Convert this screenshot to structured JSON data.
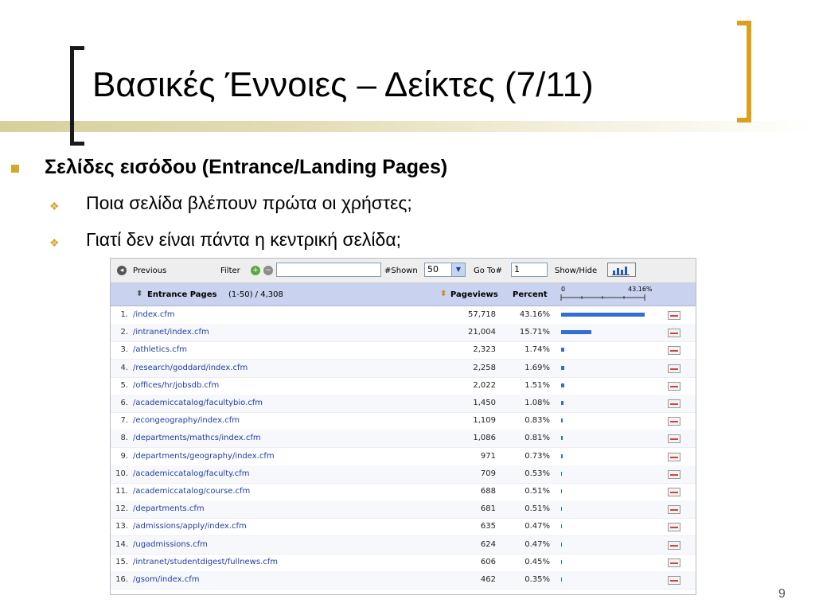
{
  "slide": {
    "title": "Βασικές Έννοιες – Δείκτες (7/11)",
    "bullet": "Σελίδες εισόδου (Entrance/Landing Pages)",
    "subbullets": [
      "Ποια σελίδα βλέπουν πρώτα οι χρήστες;",
      "Γιατί δεν είναι πάντα η κεντρική σελίδα;"
    ],
    "page_number": "9"
  },
  "controls": {
    "previous_label": "Previous",
    "filter_label": "Filter",
    "filter_value": "",
    "shown_label": "#Shown",
    "shown_value": "50",
    "goto_label": "Go To#",
    "goto_value": "1",
    "showhide_label": "Show/Hide"
  },
  "table": {
    "header_pages": "Entrance Pages",
    "header_range": "(1-50) / 4,308",
    "header_pageviews": "Pageviews",
    "header_percent": "Percent",
    "scale_min": "0",
    "scale_max": "43.16%",
    "rows": [
      {
        "num": "1.",
        "page": "/index.cfm",
        "pageviews": "57,718",
        "percent": "43.16%",
        "pct": 43.16
      },
      {
        "num": "2.",
        "page": "/intranet/index.cfm",
        "pageviews": "21,004",
        "percent": "15.71%",
        "pct": 15.71
      },
      {
        "num": "3.",
        "page": "/athletics.cfm",
        "pageviews": "2,323",
        "percent": "1.74%",
        "pct": 1.74
      },
      {
        "num": "4.",
        "page": "/research/goddard/index.cfm",
        "pageviews": "2,258",
        "percent": "1.69%",
        "pct": 1.69
      },
      {
        "num": "5.",
        "page": "/offices/hr/jobsdb.cfm",
        "pageviews": "2,022",
        "percent": "1.51%",
        "pct": 1.51
      },
      {
        "num": "6.",
        "page": "/academiccatalog/facultybio.cfm",
        "pageviews": "1,450",
        "percent": "1.08%",
        "pct": 1.08
      },
      {
        "num": "7.",
        "page": "/econgeography/index.cfm",
        "pageviews": "1,109",
        "percent": "0.83%",
        "pct": 0.83
      },
      {
        "num": "8.",
        "page": "/departments/mathcs/index.cfm",
        "pageviews": "1,086",
        "percent": "0.81%",
        "pct": 0.81
      },
      {
        "num": "9.",
        "page": "/departments/geography/index.cfm",
        "pageviews": "971",
        "percent": "0.73%",
        "pct": 0.73
      },
      {
        "num": "10.",
        "page": "/academiccatalog/faculty.cfm",
        "pageviews": "709",
        "percent": "0.53%",
        "pct": 0.53
      },
      {
        "num": "11.",
        "page": "/academiccatalog/course.cfm",
        "pageviews": "688",
        "percent": "0.51%",
        "pct": 0.51
      },
      {
        "num": "12.",
        "page": "/departments.cfm",
        "pageviews": "681",
        "percent": "0.51%",
        "pct": 0.51
      },
      {
        "num": "13.",
        "page": "/admissions/apply/index.cfm",
        "pageviews": "635",
        "percent": "0.47%",
        "pct": 0.47
      },
      {
        "num": "14.",
        "page": "/ugadmissions.cfm",
        "pageviews": "624",
        "percent": "0.47%",
        "pct": 0.47
      },
      {
        "num": "15.",
        "page": "/intranet/studentdigest/fullnews.cfm",
        "pageviews": "606",
        "percent": "0.45%",
        "pct": 0.45
      },
      {
        "num": "16.",
        "page": "/gsom/index.cfm",
        "pageviews": "462",
        "percent": "0.35%",
        "pct": 0.35
      }
    ]
  }
}
